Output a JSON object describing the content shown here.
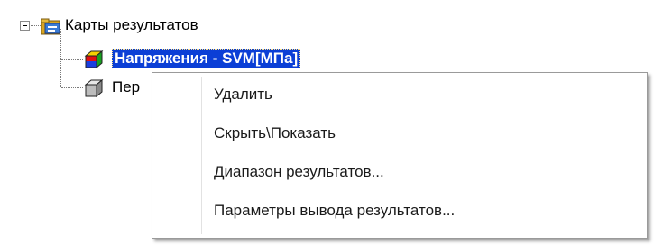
{
  "tree": {
    "root": {
      "label": "Карты результатов",
      "expander": "minus",
      "icon": "folder-results-icon"
    },
    "children": [
      {
        "label": "Напряжения - SVM[МПа]",
        "icon": "stress-map-colored-cube-icon",
        "selected": true
      },
      {
        "label": "Пер",
        "icon": "displacement-map-gray-cube-icon",
        "selected": false
      }
    ]
  },
  "context_menu": {
    "items": [
      {
        "label": "Удалить"
      },
      {
        "label": "Скрыть\\Показать"
      },
      {
        "label": "Диапазон результатов..."
      },
      {
        "label": "Параметры вывода результатов..."
      }
    ]
  },
  "colors": {
    "selection_background": "#0b3fd6",
    "selection_text": "#ffffff",
    "menu_border": "#9a9a9a",
    "menu_background": "#ffffff"
  }
}
